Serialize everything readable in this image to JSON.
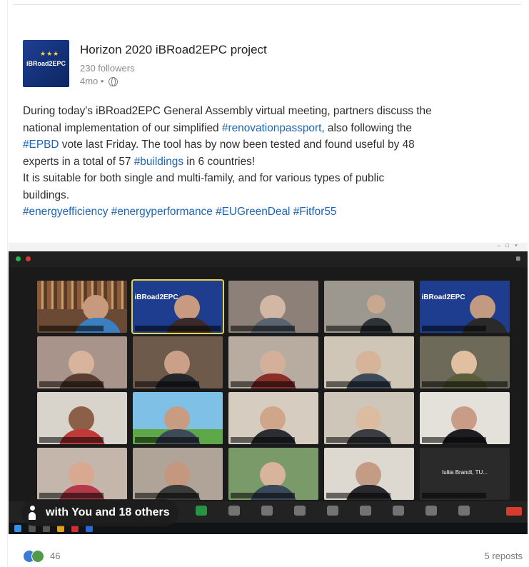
{
  "post": {
    "author": "Horizon 2020 iBRoad2EPC project",
    "followers": "230 followers",
    "age": "4mo •",
    "visibility_icon": "globe-icon",
    "logo_text": "iBRoad2EPC",
    "text": {
      "l1": "During today's iBRoad2EPC General Assembly virtual meeting, partners discuss the",
      "l2a": "national implementation of our simplified ",
      "l2tag": "#renovationpassport",
      "l2b": ", also following the",
      "l3tag": "#EPBD",
      "l3b": " vote last Friday. The tool has by now been tested and found useful by 48",
      "l4a": "experts in a total of 57 ",
      "l4tag": "#buildings",
      "l4b": " in 6 countries!",
      "l5": "It is suitable for both single and multi-family, and for various types of public",
      "l6": "buildings.",
      "hashtags": "#energyefficiency #energyperformance #EUGreenDeal #Fitfor55"
    }
  },
  "meeting_image": {
    "tile_logo_text": "iBRoad2EPC",
    "last_tile_name": "Iuliia Brandt, TU..."
  },
  "tagged": {
    "label": "with You and 18 others"
  },
  "footer": {
    "reaction_count": "46",
    "reposts": "5 reposts"
  },
  "colors": {
    "hashtag": "#1c64b5",
    "meeting_bg": "#1a1a1a",
    "active_speaker_border": "#e8d24a"
  }
}
